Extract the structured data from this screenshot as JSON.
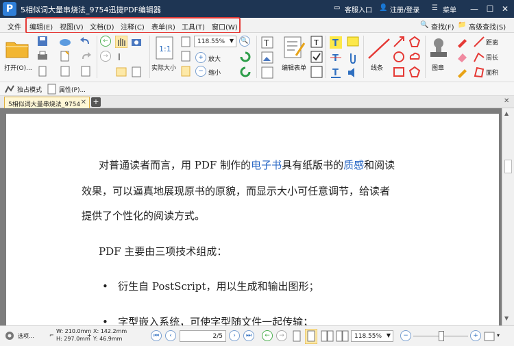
{
  "window": {
    "title": "5相似词大量串烧法_9754迅捷PDF编辑器",
    "customer_service": "客服入口",
    "login": "注册/登录",
    "menu": "菜单"
  },
  "menubar": {
    "items": [
      "文件",
      "编辑(E)",
      "视图(V)",
      "文档(D)",
      "注释(C)",
      "表单(R)",
      "工具(T)",
      "窗口(W)"
    ],
    "find": "查找(F)",
    "advanced_find": "高级查找(S)"
  },
  "toolbar": {
    "open": "打开(O)...",
    "actual_size": "实际大小",
    "zoom_value": "118.55%",
    "zoom_in": "放大",
    "zoom_out": "缩小",
    "edit_form": "编辑表单",
    "line": "线条",
    "stamp": "图章",
    "distance": "距离",
    "perimeter": "周长",
    "area": "面积",
    "exclusive_mode": "独占模式",
    "properties": "属性(P)..."
  },
  "tabs": {
    "document": "5相似词大量串烧法_9754"
  },
  "document": {
    "p1_l1_a": "对普通读者而言，用 PDF 制作的",
    "p1_l1_link1": "电子书",
    "p1_l1_b": "具有纸版书的",
    "p1_l1_link2": "质感",
    "p1_l1_c": "和阅读",
    "p1_l2": "效果，可以逼真地展现原书的原貌，而显示大小可任意调节，给读者",
    "p1_l3": "提供了个性化的阅读方式。",
    "p2": "PDF 主要由三项技术组成：",
    "bullet1": "衍生自 PostScript，用以生成和输出图形；",
    "bullet2": "字型嵌入系统，可使字型随文件一起传输；"
  },
  "statusbar": {
    "options": "选项...",
    "width": "W: 210.0mm",
    "height": "H: 297.0mm",
    "x": "X: 142.2mm",
    "y": "Y: 46.9mm",
    "page_input": "2",
    "page_total": "/5",
    "zoom": "118.55%"
  },
  "colors": {
    "titlebar": "#1e3553",
    "highlight": "#e53935",
    "link": "#2867c4"
  }
}
